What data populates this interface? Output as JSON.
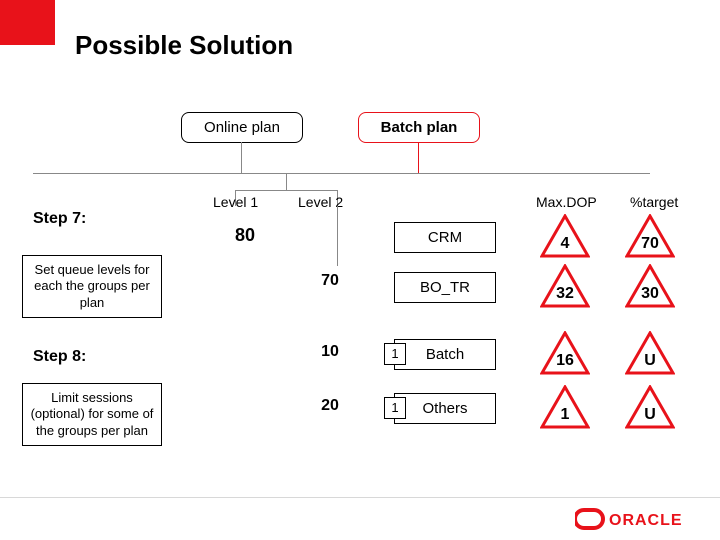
{
  "title": "Possible Solution",
  "plans": [
    "Online plan",
    "Batch plan"
  ],
  "levels": [
    "Level 1",
    "Level 2"
  ],
  "columns": [
    "Max.DOP",
    "%target"
  ],
  "level1_value": "80",
  "left": {
    "step7": "Step 7:",
    "step7_desc": "Set queue levels for each the groups per plan",
    "step8": "Step 8:",
    "step8_desc": "Limit sessions (optional) for some of the groups per plan"
  },
  "rows": [
    {
      "group": "CRM",
      "level2": "70",
      "maxdop": "4",
      "target": "70",
      "priority": ""
    },
    {
      "group": "BO_TR",
      "level2": "",
      "maxdop": "32",
      "target": "30",
      "priority": ""
    },
    {
      "group": "Batch",
      "level2": "10",
      "maxdop": "16",
      "target": "U",
      "priority": "1"
    },
    {
      "group": "Others",
      "level2": "20",
      "maxdop": "1",
      "target": "U",
      "priority": "1"
    }
  ]
}
